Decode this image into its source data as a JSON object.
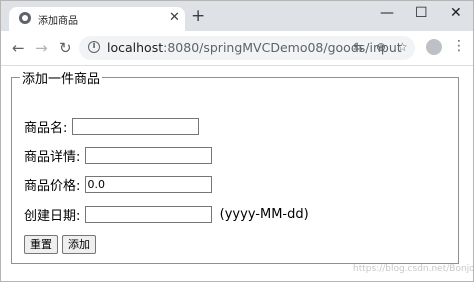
{
  "browser": {
    "tab_title": "添加商品",
    "tab_close": "✕",
    "new_tab": "+",
    "window_controls": {
      "minimize": "—",
      "maximize": "☐",
      "close": "✕"
    },
    "url_host": "localhost",
    "url_path": ":8080/springMVCDemo08/goods/input",
    "icons": [
      "back-icon",
      "forward-icon",
      "reload-icon",
      "info-icon",
      "translate-icon",
      "zoom-icon",
      "star-icon",
      "avatar-icon",
      "menu-icon"
    ]
  },
  "form": {
    "legend": "添加一件商品",
    "name_label": "商品名:",
    "name_value": "",
    "detail_label": "商品详情:",
    "detail_value": "",
    "price_label": "商品价格:",
    "price_value": "0.0",
    "date_label": "创建日期:",
    "date_value": "",
    "date_hint": "(yyyy-MM-dd)",
    "reset_button": "重置",
    "submit_button": "添加"
  },
  "watermark": "https://blog.csdn.net/Bonjou..."
}
